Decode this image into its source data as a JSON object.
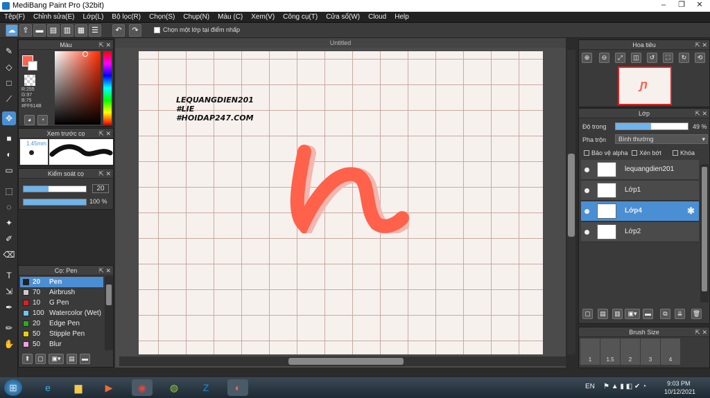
{
  "title": "MediBang Paint Pro (32bit)",
  "window_controls": {
    "minimize": "–",
    "maximize": "❐",
    "close": "✕"
  },
  "menu": [
    "Tệp(F)",
    "Chỉnh sửa(E)",
    "Lớp(L)",
    "Bộ lọc(R)",
    "Chọn(S)",
    "Chụp(N)",
    "Màu (C)",
    "Xem(V)",
    "Công cụ(T)",
    "Cửa sổ(W)",
    "Cloud",
    "Help"
  ],
  "toolbar": {
    "checkbox_label": "Chọn một lớp tại điểm nhấp"
  },
  "color_panel": {
    "title": "Màu",
    "r": "R:255",
    "g": "G:97",
    "b": "B:75",
    "hex": "#FF614B",
    "fg_color": "#ff614b",
    "bg_color": "#ffffff"
  },
  "brush_preview": {
    "title": "Xem trước cọ",
    "size": "1.45mm"
  },
  "brush_control": {
    "title": "Kiểm soát cọ",
    "width_value": "20",
    "opacity_value": "100 %"
  },
  "brush_list": {
    "title": "Cọ: Pen",
    "items": [
      {
        "size": "20",
        "name": "Pen",
        "color": "#222222",
        "selected": true
      },
      {
        "size": "70",
        "name": "Airbrush",
        "color": "#cccccc"
      },
      {
        "size": "10",
        "name": "G Pen",
        "color": "#e02020"
      },
      {
        "size": "100",
        "name": "Watercolor (Wet)",
        "color": "#6ec6f0"
      },
      {
        "size": "20",
        "name": "Edge Pen",
        "color": "#20b020"
      },
      {
        "size": "50",
        "name": "Stipple Pen",
        "color": "#e8d000"
      },
      {
        "size": "50",
        "name": "Blur",
        "color": "#f0a0e0"
      }
    ]
  },
  "canvas": {
    "tab_title": "Untitled",
    "text_lines": [
      "LEQUANGDIEN201",
      "#LIE",
      "#HOIDAP247.COM"
    ],
    "stroke_color": "#ff614b"
  },
  "navigator": {
    "title": "Hoa tiêu"
  },
  "layer_panel": {
    "title": "Lớp",
    "opacity_label": "Độ trong",
    "opacity_value": "49 %",
    "opacity_fraction": 0.49,
    "blend_label": "Pha trộn",
    "blend_value": "Bình thường",
    "protect_alpha": "Bảo vệ alpha",
    "clipping": "Xén bớt",
    "lock": "Khóa",
    "layers": [
      {
        "name": "lequangdien201",
        "selected": false
      },
      {
        "name": "Lớp1",
        "selected": false
      },
      {
        "name": "Lớp4",
        "selected": true
      },
      {
        "name": "Lớp2",
        "selected": false
      }
    ]
  },
  "brush_size_panel": {
    "title": "Brush Size",
    "sizes": [
      "1",
      "1.5",
      "2",
      "3",
      "4"
    ]
  },
  "taskbar": {
    "lang": "EN",
    "time": "9:03 PM",
    "date": "10/12/2021"
  }
}
